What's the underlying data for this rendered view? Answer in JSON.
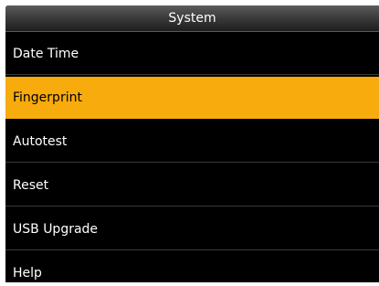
{
  "header": {
    "title": "System"
  },
  "menu": {
    "selected_index": 1,
    "items": [
      {
        "label": "Date Time"
      },
      {
        "label": "Fingerprint"
      },
      {
        "label": "Autotest"
      },
      {
        "label": "Reset"
      },
      {
        "label": "USB Upgrade"
      },
      {
        "label": "Help"
      }
    ]
  },
  "colors": {
    "selected_background": "#f7ab0c",
    "screen_background": "#000000",
    "text": "#ffffff"
  }
}
